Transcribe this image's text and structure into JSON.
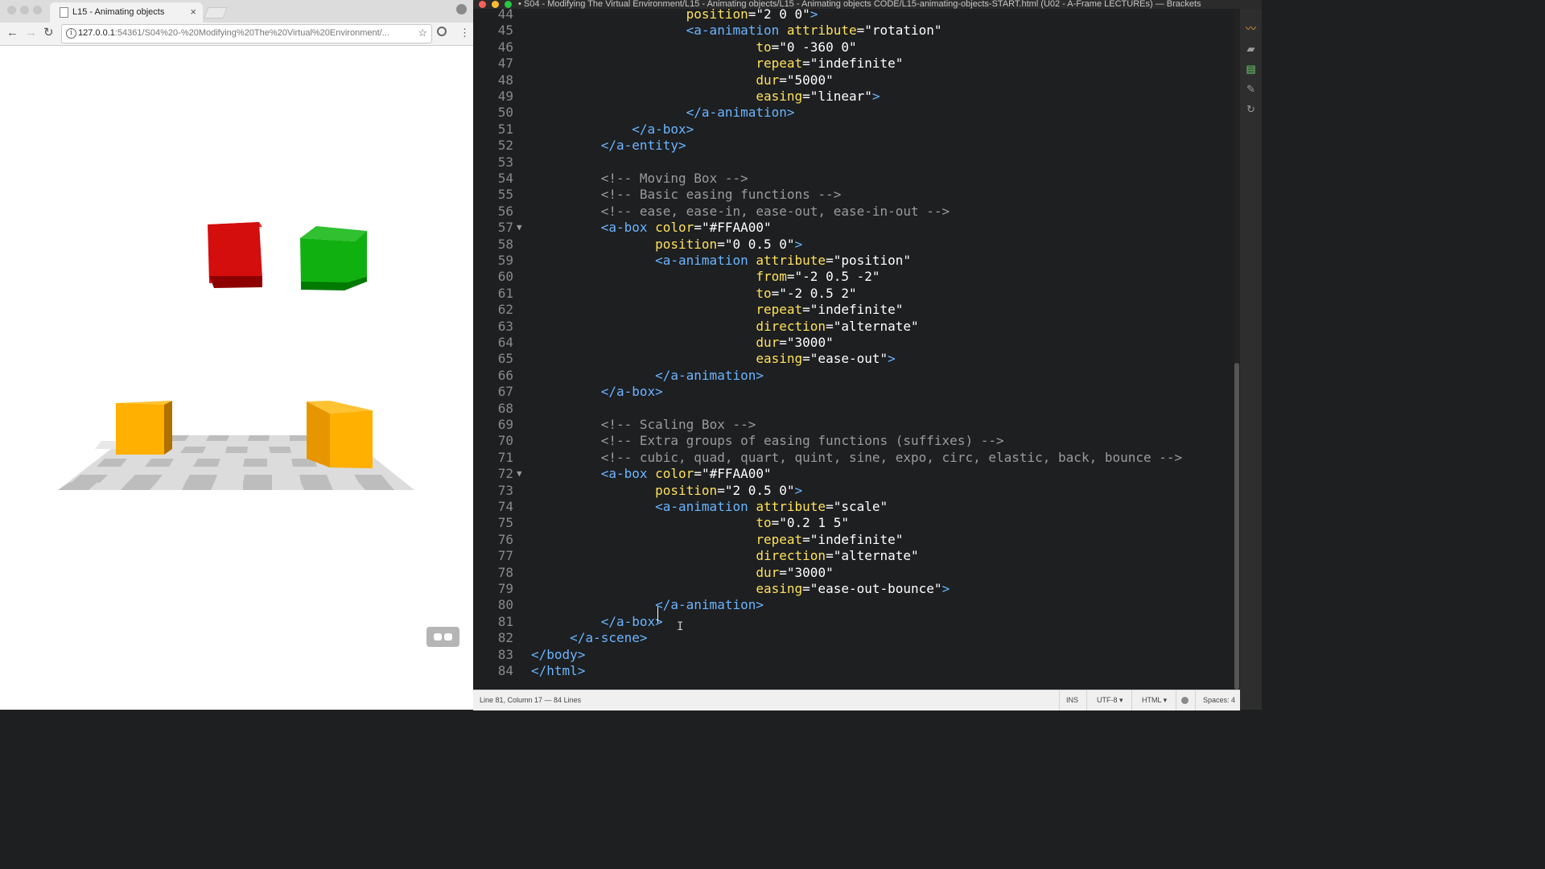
{
  "browser": {
    "tab_title": "L15 - Animating objects",
    "tab_close": "×",
    "url_host": "127.0.0.1",
    "url_rest": ":54361/S04%20-%20Modifying%20The%20Virtual%20Environment/...",
    "back": "←",
    "forward": "→",
    "reload": "↻",
    "star": "☆",
    "menu": "⋮",
    "scene": {
      "sky_color": "#ffffff",
      "boxes": [
        {
          "name": "red-box",
          "color": "#d00000"
        },
        {
          "name": "green-box",
          "color": "#00b000"
        },
        {
          "name": "yellow-box-left",
          "color": "#ffb000"
        },
        {
          "name": "yellow-box-right",
          "color": "#ffb000"
        }
      ],
      "floor": "checkerboard"
    }
  },
  "editor": {
    "title": "• S04 - Modifying The Virtual Environment/L15 - Animating objects/L15 - Animating objects CODE/L15-animating-objects-START.html (U02 - A-Frame LECTUREs) — Brackets",
    "lines": [
      {
        "n": "44",
        "fold": "",
        "tokens": [
          {
            "c": "t-txt",
            "t": "                    "
          },
          {
            "c": "t-attr",
            "t": "position"
          },
          {
            "c": "t-txt",
            "t": "="
          },
          {
            "c": "t-str",
            "t": "\"2 0 0\""
          },
          {
            "c": "t-tag",
            "t": ">"
          }
        ]
      },
      {
        "n": "45",
        "fold": "",
        "tokens": [
          {
            "c": "t-txt",
            "t": "                    "
          },
          {
            "c": "t-tag",
            "t": "<a-animation"
          },
          {
            "c": "t-txt",
            "t": " "
          },
          {
            "c": "t-attr",
            "t": "attribute"
          },
          {
            "c": "t-txt",
            "t": "="
          },
          {
            "c": "t-str",
            "t": "\"rotation\""
          }
        ]
      },
      {
        "n": "46",
        "fold": "",
        "tokens": [
          {
            "c": "t-txt",
            "t": "                             "
          },
          {
            "c": "t-attr",
            "t": "to"
          },
          {
            "c": "t-txt",
            "t": "="
          },
          {
            "c": "t-str",
            "t": "\"0 -360 0\""
          }
        ]
      },
      {
        "n": "47",
        "fold": "",
        "tokens": [
          {
            "c": "t-txt",
            "t": "                             "
          },
          {
            "c": "t-attr",
            "t": "repeat"
          },
          {
            "c": "t-txt",
            "t": "="
          },
          {
            "c": "t-str",
            "t": "\"indefinite\""
          }
        ]
      },
      {
        "n": "48",
        "fold": "",
        "tokens": [
          {
            "c": "t-txt",
            "t": "                             "
          },
          {
            "c": "t-attr",
            "t": "dur"
          },
          {
            "c": "t-txt",
            "t": "="
          },
          {
            "c": "t-str",
            "t": "\"5000\""
          }
        ]
      },
      {
        "n": "49",
        "fold": "",
        "tokens": [
          {
            "c": "t-txt",
            "t": "                             "
          },
          {
            "c": "t-attr",
            "t": "easing"
          },
          {
            "c": "t-txt",
            "t": "="
          },
          {
            "c": "t-str",
            "t": "\"linear\""
          },
          {
            "c": "t-tag",
            "t": ">"
          }
        ]
      },
      {
        "n": "50",
        "fold": "",
        "tokens": [
          {
            "c": "t-txt",
            "t": "                    "
          },
          {
            "c": "t-tag",
            "t": "</a-animation>"
          }
        ]
      },
      {
        "n": "51",
        "fold": "",
        "tokens": [
          {
            "c": "t-txt",
            "t": "             "
          },
          {
            "c": "t-tag",
            "t": "</a-box>"
          }
        ]
      },
      {
        "n": "52",
        "fold": "",
        "tokens": [
          {
            "c": "t-txt",
            "t": "         "
          },
          {
            "c": "t-tag",
            "t": "</a-entity>"
          }
        ]
      },
      {
        "n": "53",
        "fold": "",
        "tokens": []
      },
      {
        "n": "54",
        "fold": "",
        "tokens": [
          {
            "c": "t-txt",
            "t": "         "
          },
          {
            "c": "t-cm",
            "t": "<!-- Moving Box -->"
          }
        ]
      },
      {
        "n": "55",
        "fold": "",
        "tokens": [
          {
            "c": "t-txt",
            "t": "         "
          },
          {
            "c": "t-cm",
            "t": "<!-- Basic easing functions -->"
          }
        ]
      },
      {
        "n": "56",
        "fold": "",
        "tokens": [
          {
            "c": "t-txt",
            "t": "         "
          },
          {
            "c": "t-cm",
            "t": "<!-- ease, ease-in, ease-out, ease-in-out -->"
          }
        ]
      },
      {
        "n": "57",
        "fold": "▼",
        "tokens": [
          {
            "c": "t-txt",
            "t": "         "
          },
          {
            "c": "t-tag",
            "t": "<a-box"
          },
          {
            "c": "t-txt",
            "t": " "
          },
          {
            "c": "t-attr",
            "t": "color"
          },
          {
            "c": "t-txt",
            "t": "="
          },
          {
            "c": "t-str",
            "t": "\"#FFAA00\""
          }
        ]
      },
      {
        "n": "58",
        "fold": "",
        "tokens": [
          {
            "c": "t-txt",
            "t": "                "
          },
          {
            "c": "t-attr",
            "t": "position"
          },
          {
            "c": "t-txt",
            "t": "="
          },
          {
            "c": "t-str",
            "t": "\"0 0.5 0\""
          },
          {
            "c": "t-tag",
            "t": ">"
          }
        ]
      },
      {
        "n": "59",
        "fold": "",
        "tokens": [
          {
            "c": "t-txt",
            "t": "                "
          },
          {
            "c": "t-tag",
            "t": "<a-animation"
          },
          {
            "c": "t-txt",
            "t": " "
          },
          {
            "c": "t-attr",
            "t": "attribute"
          },
          {
            "c": "t-txt",
            "t": "="
          },
          {
            "c": "t-str",
            "t": "\"position\""
          }
        ]
      },
      {
        "n": "60",
        "fold": "",
        "tokens": [
          {
            "c": "t-txt",
            "t": "                             "
          },
          {
            "c": "t-attr",
            "t": "from"
          },
          {
            "c": "t-txt",
            "t": "="
          },
          {
            "c": "t-str",
            "t": "\"-2 0.5 -2\""
          }
        ]
      },
      {
        "n": "61",
        "fold": "",
        "tokens": [
          {
            "c": "t-txt",
            "t": "                             "
          },
          {
            "c": "t-attr",
            "t": "to"
          },
          {
            "c": "t-txt",
            "t": "="
          },
          {
            "c": "t-str",
            "t": "\"-2 0.5 2\""
          }
        ]
      },
      {
        "n": "62",
        "fold": "",
        "tokens": [
          {
            "c": "t-txt",
            "t": "                             "
          },
          {
            "c": "t-attr",
            "t": "repeat"
          },
          {
            "c": "t-txt",
            "t": "="
          },
          {
            "c": "t-str",
            "t": "\"indefinite\""
          }
        ]
      },
      {
        "n": "63",
        "fold": "",
        "tokens": [
          {
            "c": "t-txt",
            "t": "                             "
          },
          {
            "c": "t-attr",
            "t": "direction"
          },
          {
            "c": "t-txt",
            "t": "="
          },
          {
            "c": "t-str",
            "t": "\"alternate\""
          }
        ]
      },
      {
        "n": "64",
        "fold": "",
        "tokens": [
          {
            "c": "t-txt",
            "t": "                             "
          },
          {
            "c": "t-attr",
            "t": "dur"
          },
          {
            "c": "t-txt",
            "t": "="
          },
          {
            "c": "t-str",
            "t": "\"3000\""
          }
        ]
      },
      {
        "n": "65",
        "fold": "",
        "tokens": [
          {
            "c": "t-txt",
            "t": "                             "
          },
          {
            "c": "t-attr",
            "t": "easing"
          },
          {
            "c": "t-txt",
            "t": "="
          },
          {
            "c": "t-str",
            "t": "\"ease-out\""
          },
          {
            "c": "t-tag",
            "t": ">"
          }
        ]
      },
      {
        "n": "66",
        "fold": "",
        "tokens": [
          {
            "c": "t-txt",
            "t": "                "
          },
          {
            "c": "t-tag",
            "t": "</a-animation>"
          }
        ]
      },
      {
        "n": "67",
        "fold": "",
        "tokens": [
          {
            "c": "t-txt",
            "t": "         "
          },
          {
            "c": "t-tag",
            "t": "</a-box>"
          }
        ]
      },
      {
        "n": "68",
        "fold": "",
        "tokens": []
      },
      {
        "n": "69",
        "fold": "",
        "tokens": [
          {
            "c": "t-txt",
            "t": "         "
          },
          {
            "c": "t-cm",
            "t": "<!-- Scaling Box -->"
          }
        ]
      },
      {
        "n": "70",
        "fold": "",
        "tokens": [
          {
            "c": "t-txt",
            "t": "         "
          },
          {
            "c": "t-cm",
            "t": "<!-- Extra groups of easing functions (suffixes) -->"
          }
        ]
      },
      {
        "n": "71",
        "fold": "",
        "tokens": [
          {
            "c": "t-txt",
            "t": "         "
          },
          {
            "c": "t-cm",
            "t": "<!-- cubic, quad, quart, quint, sine, expo, circ, elastic, back, bounce -->"
          }
        ]
      },
      {
        "n": "72",
        "fold": "▼",
        "tokens": [
          {
            "c": "t-txt",
            "t": "         "
          },
          {
            "c": "t-tag",
            "t": "<a-box"
          },
          {
            "c": "t-txt",
            "t": " "
          },
          {
            "c": "t-attr",
            "t": "color"
          },
          {
            "c": "t-txt",
            "t": "="
          },
          {
            "c": "t-str",
            "t": "\"#FFAA00\""
          }
        ]
      },
      {
        "n": "73",
        "fold": "",
        "tokens": [
          {
            "c": "t-txt",
            "t": "                "
          },
          {
            "c": "t-attr",
            "t": "position"
          },
          {
            "c": "t-txt",
            "t": "="
          },
          {
            "c": "t-str",
            "t": "\"2 0.5 0\""
          },
          {
            "c": "t-tag",
            "t": ">"
          }
        ]
      },
      {
        "n": "74",
        "fold": "",
        "tokens": [
          {
            "c": "t-txt",
            "t": "                "
          },
          {
            "c": "t-tag",
            "t": "<a-animation"
          },
          {
            "c": "t-txt",
            "t": " "
          },
          {
            "c": "t-attr",
            "t": "attribute"
          },
          {
            "c": "t-txt",
            "t": "="
          },
          {
            "c": "t-str",
            "t": "\"scale\""
          }
        ]
      },
      {
        "n": "75",
        "fold": "",
        "tokens": [
          {
            "c": "t-txt",
            "t": "                             "
          },
          {
            "c": "t-attr",
            "t": "to"
          },
          {
            "c": "t-txt",
            "t": "="
          },
          {
            "c": "t-str",
            "t": "\"0.2 1 5\""
          }
        ]
      },
      {
        "n": "76",
        "fold": "",
        "tokens": [
          {
            "c": "t-txt",
            "t": "                             "
          },
          {
            "c": "t-attr",
            "t": "repeat"
          },
          {
            "c": "t-txt",
            "t": "="
          },
          {
            "c": "t-str",
            "t": "\"indefinite\""
          }
        ]
      },
      {
        "n": "77",
        "fold": "",
        "tokens": [
          {
            "c": "t-txt",
            "t": "                             "
          },
          {
            "c": "t-attr",
            "t": "direction"
          },
          {
            "c": "t-txt",
            "t": "="
          },
          {
            "c": "t-str",
            "t": "\"alternate\""
          }
        ]
      },
      {
        "n": "78",
        "fold": "",
        "tokens": [
          {
            "c": "t-txt",
            "t": "                             "
          },
          {
            "c": "t-attr",
            "t": "dur"
          },
          {
            "c": "t-txt",
            "t": "="
          },
          {
            "c": "t-str",
            "t": "\"3000\""
          }
        ]
      },
      {
        "n": "79",
        "fold": "",
        "tokens": [
          {
            "c": "t-txt",
            "t": "                             "
          },
          {
            "c": "t-attr",
            "t": "easing"
          },
          {
            "c": "t-txt",
            "t": "="
          },
          {
            "c": "t-str",
            "t": "\"ease-out-bounce\""
          },
          {
            "c": "t-tag",
            "t": ">"
          }
        ]
      },
      {
        "n": "80",
        "fold": "",
        "tokens": [
          {
            "c": "t-txt",
            "t": "                "
          },
          {
            "c": "t-tag",
            "t": "</a-animation>"
          }
        ]
      },
      {
        "n": "81",
        "fold": "",
        "tokens": [
          {
            "c": "t-txt",
            "t": "         "
          },
          {
            "c": "t-tag",
            "t": "</a-box>"
          }
        ]
      },
      {
        "n": "82",
        "fold": "",
        "tokens": [
          {
            "c": "t-txt",
            "t": "     "
          },
          {
            "c": "t-tag",
            "t": "</a-scene>"
          }
        ]
      },
      {
        "n": "83",
        "fold": "",
        "tokens": [
          {
            "c": "t-tag",
            "t": "</body>"
          }
        ]
      },
      {
        "n": "84",
        "fold": "",
        "tokens": [
          {
            "c": "t-tag",
            "t": "</html>"
          }
        ]
      }
    ],
    "status": {
      "position": "Line 81, Column 17 — 84 Lines",
      "mode": "INS",
      "encoding": "UTF-8 ▾",
      "language": "HTML ▾",
      "spaces": "Spaces: 4"
    },
    "colors": {
      "tag": "#6bb5ff",
      "attr": "#ffe15b",
      "string": "#ffffff",
      "comment": "#9b9b9b",
      "background": "#1d1f21"
    }
  }
}
